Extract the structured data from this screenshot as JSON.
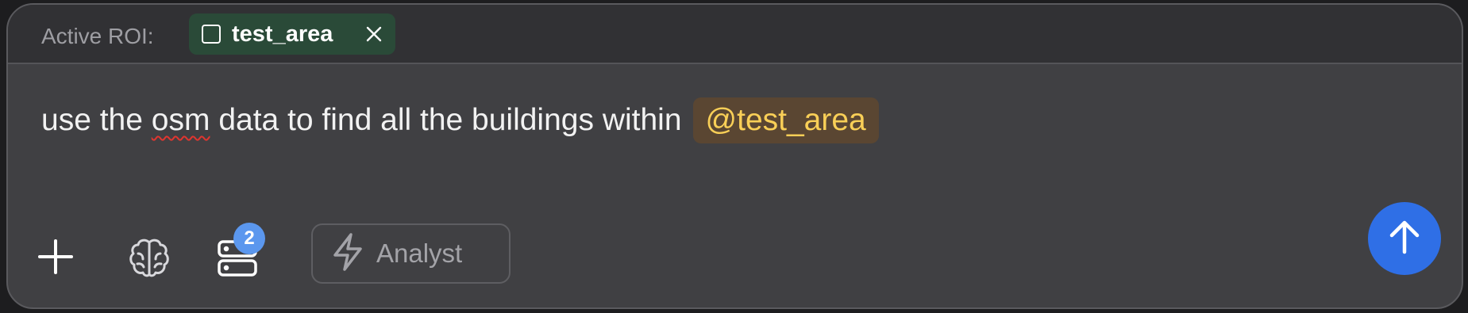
{
  "roi": {
    "label": "Active ROI:",
    "chip_name": "test_area",
    "chip_color": "#2a4a38"
  },
  "prompt": {
    "before": "use the",
    "misspelled_word": "osm",
    "after": "data to find all the buildings within",
    "mention": "@test_area",
    "mention_color": "#f9cf57"
  },
  "toolbar": {
    "add_icon": "plus-icon",
    "model_icon": "brain-icon",
    "datasets_icon": "server-stack-icon",
    "datasets_badge": "2",
    "mode_icon": "lightning-icon",
    "mode_label": "Analyst",
    "send_icon": "arrow-up-icon",
    "send_color": "#2f6fe6"
  }
}
